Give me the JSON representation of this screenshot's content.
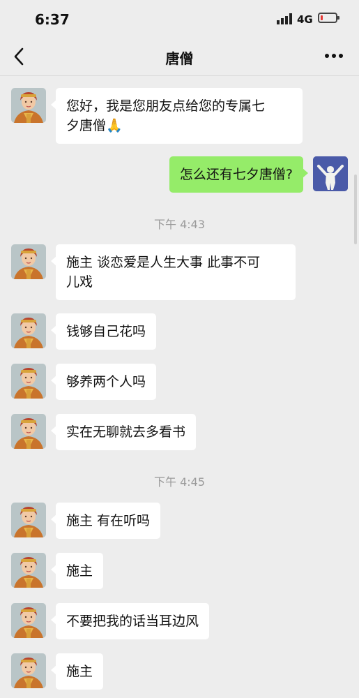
{
  "status_bar": {
    "time": "6:37",
    "network": "4G",
    "battery_color": "#e53935"
  },
  "nav": {
    "title": "唐僧"
  },
  "timestamps": [
    "下午 4:43",
    "下午 4:45"
  ],
  "messages": [
    {
      "sender": "other",
      "text": "您好，我是您朋友点给您的专属七\n夕唐僧🙏"
    },
    {
      "sender": "me",
      "text": "怎么还有七夕唐僧?"
    },
    {
      "sender": "other",
      "text": "施主 谈恋爱是人生大事 此事不可\n儿戏"
    },
    {
      "sender": "other",
      "text": "钱够自己花吗"
    },
    {
      "sender": "other",
      "text": "够养两个人吗"
    },
    {
      "sender": "other",
      "text": "实在无聊就去多看书"
    },
    {
      "sender": "other",
      "text": "施主 有在听吗"
    },
    {
      "sender": "other",
      "text": "施主"
    },
    {
      "sender": "other",
      "text": "不要把我的话当耳边风"
    },
    {
      "sender": "other",
      "text": "施主"
    }
  ],
  "colors": {
    "bubble_me": "#95ec69",
    "bubble_other": "#ffffff",
    "background": "#ededed"
  }
}
